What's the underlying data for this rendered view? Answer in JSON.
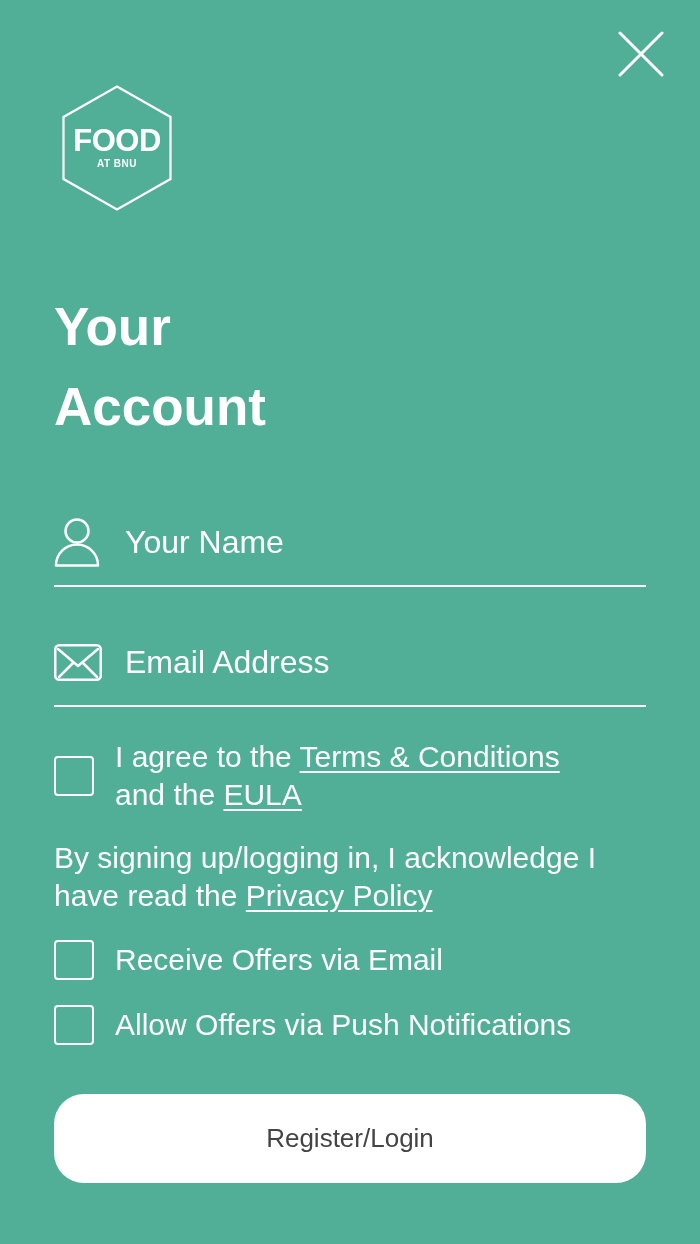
{
  "logo": {
    "title": "FOOD",
    "subtitle": "AT BNU"
  },
  "title": {
    "lines": [
      "Your",
      "Account"
    ]
  },
  "fields": [
    {
      "kind": "name",
      "placeholder": "Your Name"
    },
    {
      "kind": "email",
      "placeholder": "Email Address"
    }
  ],
  "consents": [
    {
      "kind": "checkbox",
      "checked": false,
      "parts": [
        {
          "kind": "text",
          "text": "I agree to the "
        },
        {
          "kind": "link",
          "text": "Terms & Conditions"
        },
        {
          "kind": "text",
          "text": " and the "
        },
        {
          "kind": "link",
          "text": "EULA"
        }
      ]
    },
    {
      "kind": "note",
      "parts": [
        {
          "kind": "text",
          "text": "By signing up/logging in, I acknowledge I have read the "
        },
        {
          "kind": "link",
          "text": "Privacy Policy"
        }
      ]
    },
    {
      "kind": "checkbox",
      "checked": false,
      "parts": [
        {
          "kind": "text",
          "text": "Receive Offers via Email"
        }
      ]
    },
    {
      "kind": "checkbox",
      "checked": false,
      "parts": [
        {
          "kind": "text",
          "text": "Allow Offers via Push Notifications"
        }
      ]
    }
  ],
  "submit_button": {
    "label": "Register/Login"
  }
}
